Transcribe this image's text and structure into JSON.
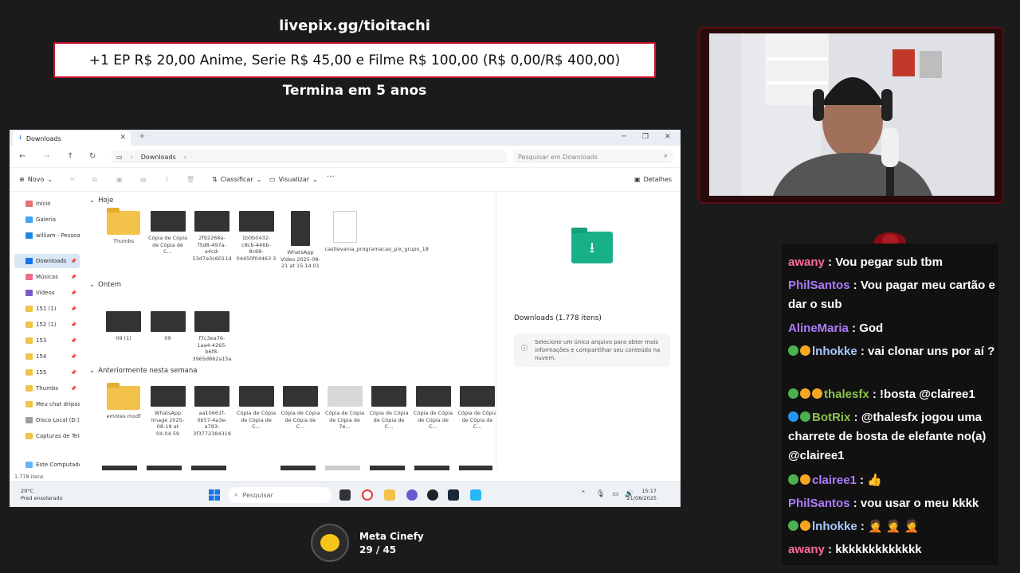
{
  "goal": {
    "url": "livepix.gg/tioitachi",
    "text": "+1 EP R$ 20,00 Anime, Serie R$ 45,00 e Filme R$ 100,00 (R$ 0,00/R$ 400,00)",
    "ends": "Termina em 5 anos"
  },
  "explorer": {
    "tab_title": "Downloads",
    "breadcrumb": "Downloads",
    "search_placeholder": "Pesquisar em Downloads",
    "commands": {
      "new": "Novo",
      "sort": "Classificar",
      "view": "Visualizar",
      "more": "···",
      "details": "Detalhes"
    },
    "sidebar": [
      {
        "label": "Início",
        "icon": "home-icon"
      },
      {
        "label": "Galeria",
        "icon": "gallery-icon"
      },
      {
        "label": "william - Pessoal",
        "icon": "onedrive-icon"
      },
      {
        "label": "Downloads",
        "icon": "download-icon",
        "selected": true
      },
      {
        "label": "Músicas",
        "icon": "music-icon"
      },
      {
        "label": "Vídeos",
        "icon": "video-icon"
      },
      {
        "label": "151 (1)",
        "icon": "folder-icon"
      },
      {
        "label": "152 (1)",
        "icon": "folder-icon"
      },
      {
        "label": "153",
        "icon": "folder-icon"
      },
      {
        "label": "154",
        "icon": "folder-icon"
      },
      {
        "label": "155",
        "icon": "folder-icon"
      },
      {
        "label": "Thumbs",
        "icon": "folder-icon"
      },
      {
        "label": "Meu chat dripas",
        "icon": "folder-icon"
      },
      {
        "label": "Disco Local (D:)",
        "icon": "drive-icon"
      },
      {
        "label": "Capturas de Tela",
        "icon": "folder-icon"
      },
      {
        "label": "Este Computador",
        "icon": "computer-icon"
      }
    ],
    "groups": {
      "today": "Hoje",
      "yesterday": "Ontem",
      "earlier": "Anteriormente nesta semana"
    },
    "files_today": [
      "Thumbs",
      "Cópia de Cópia de Cópia de C...",
      "2f92268a-f5d8-497a-a4cd-53d7e3c6011d",
      "1b0b0432-c8cb-446b-8c68-04450f04463 3",
      "WhatsApp Video 2025-08-21 at 15.14.01",
      "castlevania_programacao_pix_grupo_18"
    ],
    "files_yesterday": [
      "09 (1)",
      "09",
      "f7c3ea76-1aa4-4265-b6f8-3965d862a15a"
    ],
    "files_earlier": [
      "emotes modf",
      "WhatsApp Image 2025-08-19 at 04.04.59",
      "aa10661f-0b57-4a3e-a783-3f3772384319",
      "Cópia de Cópia de Cópia de C...",
      "Cópia de Cópia de Cópia de C...",
      "Cópia de Cópia de Cópia de 7e...",
      "Cópia de Cópia de Cópia de C...",
      "Cópia de Cópia de Cópia de C...",
      "Cópia de Cópia de Cópia de C..."
    ],
    "details_title": "Downloads (1.778 itens)",
    "details_info": "Selecione um único arquivo para obter mais informações e compartilhar seu conteúdo na nuvem.",
    "status": "1.778 itens"
  },
  "taskbar": {
    "weather_temp": "29°C",
    "weather_desc": "Pred ensolarado",
    "search": "Pesquisar",
    "time": "15:17",
    "date": "21/08/2025"
  },
  "chat": [
    {
      "user": "awany",
      "color": "#ff6b9d",
      "badges": [],
      "text": "Vou pegar sub tbm"
    },
    {
      "user": "PhilSantos",
      "color": "#b07cff",
      "badges": [],
      "text": "Vou pagar meu cartão e dar o sub"
    },
    {
      "user": "AlineMaria",
      "color": "#b07cff",
      "badges": [],
      "text": "God"
    },
    {
      "user": "lnhokke",
      "color": "#a8c8ff",
      "badges": [
        "#4caf50",
        "#f5a623"
      ],
      "text": "vai clonar uns por aí ?"
    },
    {
      "user": "thalesfx",
      "color": "#8bc34a",
      "badges": [
        "#4caf50",
        "#f5a623",
        "#f5a623"
      ],
      "text": "!bosta @clairee1"
    },
    {
      "user": "BotRix",
      "color": "#8bc34a",
      "badges": [
        "#2196f3",
        "#4caf50"
      ],
      "text": "@thalesfx jogou uma charrete de bosta de elefante no(a) @clairee1"
    },
    {
      "user": "clairee1",
      "color": "#b07cff",
      "badges": [
        "#4caf50",
        "#f5a623"
      ],
      "text": "👍"
    },
    {
      "user": "PhilSantos",
      "color": "#b07cff",
      "badges": [],
      "text": "vou usar o meu kkkk"
    },
    {
      "user": "lnhokke",
      "color": "#a8c8ff",
      "badges": [
        "#4caf50",
        "#f5a623"
      ],
      "text": "🤦 🤦 🤦"
    },
    {
      "user": "awany",
      "color": "#ff6b9d",
      "badges": [],
      "text": "kkkkkkkkkkkkk"
    }
  ],
  "vote": {
    "title": "Meta Cinefy",
    "count": "29 / 45"
  }
}
